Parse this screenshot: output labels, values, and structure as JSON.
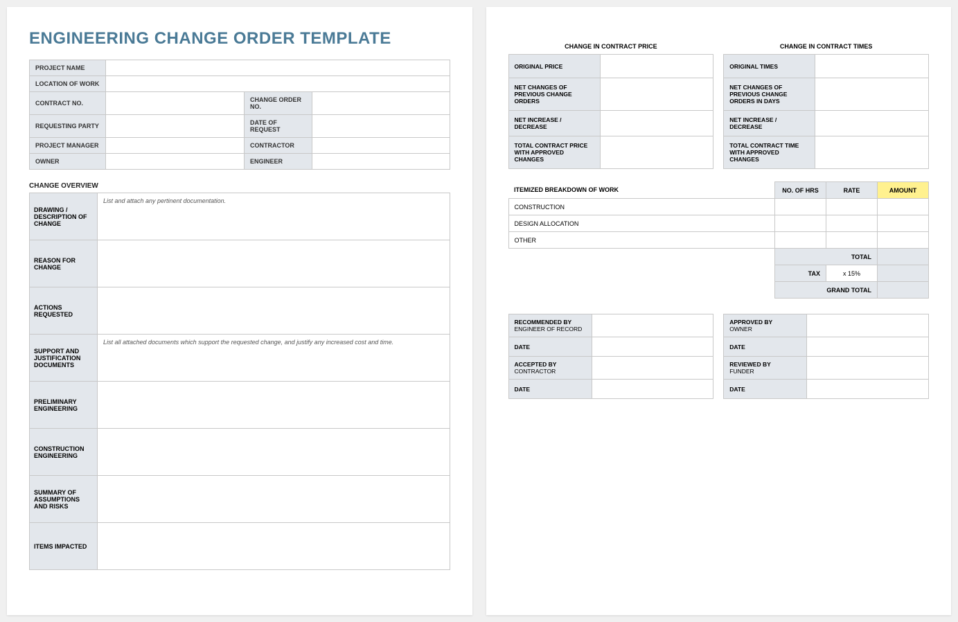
{
  "title": "ENGINEERING CHANGE ORDER TEMPLATE",
  "info": {
    "projectName": {
      "label": "PROJECT NAME",
      "value": ""
    },
    "locationOfWork": {
      "label": "LOCATION OF WORK",
      "value": ""
    },
    "contractNo": {
      "label": "CONTRACT NO.",
      "value": ""
    },
    "changeOrderNo": {
      "label": "CHANGE ORDER NO.",
      "value": ""
    },
    "requestingParty": {
      "label": "REQUESTING PARTY",
      "value": ""
    },
    "dateOfRequest": {
      "label": "DATE OF REQUEST",
      "value": ""
    },
    "projectManager": {
      "label": "PROJECT MANAGER",
      "value": ""
    },
    "contractor": {
      "label": "CONTRACTOR",
      "value": ""
    },
    "owner": {
      "label": "OWNER",
      "value": ""
    },
    "engineer": {
      "label": "ENGINEER",
      "value": ""
    }
  },
  "overview": {
    "heading": "CHANGE OVERVIEW",
    "rows": [
      {
        "label": "DRAWING / DESCRIPTION OF CHANGE",
        "value": "List and attach any pertinent documentation."
      },
      {
        "label": "REASON FOR CHANGE",
        "value": ""
      },
      {
        "label": "ACTIONS REQUESTED",
        "value": ""
      },
      {
        "label": "SUPPORT AND JUSTIFICATION DOCUMENTS",
        "value": "List all attached documents which support the requested change, and justify any increased cost and time."
      },
      {
        "label": "PRELIMINARY ENGINEERING",
        "value": ""
      },
      {
        "label": "CONSTRUCTION ENGINEERING",
        "value": ""
      },
      {
        "label": "SUMMARY OF ASSUMPTIONS AND RISKS",
        "value": ""
      },
      {
        "label": "ITEMS IMPACTED",
        "value": ""
      }
    ]
  },
  "changePrice": {
    "heading": "CHANGE IN CONTRACT PRICE",
    "rows": [
      {
        "label": "ORIGINAL PRICE",
        "value": ""
      },
      {
        "label": "NET CHANGES OF PREVIOUS CHANGE ORDERS",
        "value": ""
      },
      {
        "label": "NET INCREASE / DECREASE",
        "value": ""
      },
      {
        "label": "TOTAL CONTRACT PRICE WITH APPROVED CHANGES",
        "value": ""
      }
    ]
  },
  "changeTimes": {
    "heading": "CHANGE IN CONTRACT TIMES",
    "rows": [
      {
        "label": "ORIGINAL TIMES",
        "value": ""
      },
      {
        "label": "NET CHANGES OF PREVIOUS CHANGE ORDERS IN DAYS",
        "value": ""
      },
      {
        "label": "NET INCREASE / DECREASE",
        "value": ""
      },
      {
        "label": "TOTAL CONTRACT TIME WITH APPROVED CHANGES",
        "value": ""
      }
    ]
  },
  "itemized": {
    "heading": "ITEMIZED BREAKDOWN OF WORK",
    "columns": {
      "hrs": "NO. OF HRS",
      "rate": "RATE",
      "amount": "AMOUNT"
    },
    "rows": [
      {
        "desc": "CONSTRUCTION",
        "hrs": "",
        "rate": "",
        "amount": ""
      },
      {
        "desc": "DESIGN ALLOCATION",
        "hrs": "",
        "rate": "",
        "amount": ""
      },
      {
        "desc": "OTHER",
        "hrs": "",
        "rate": "",
        "amount": ""
      }
    ],
    "totalLabel": "TOTAL",
    "totalValue": "",
    "taxLabel": "TAX",
    "taxRate": "x 15%",
    "taxValue": "",
    "grandTotalLabel": "GRAND TOTAL",
    "grandTotalValue": ""
  },
  "signoff": {
    "left": [
      {
        "label": "RECOMMENDED BY",
        "sub": "ENGINEER OF RECORD",
        "value": ""
      },
      {
        "label": "DATE",
        "sub": "",
        "value": ""
      },
      {
        "label": "ACCEPTED BY",
        "sub": "CONTRACTOR",
        "value": ""
      },
      {
        "label": "DATE",
        "sub": "",
        "value": ""
      }
    ],
    "right": [
      {
        "label": "APPROVED BY",
        "sub": "OWNER",
        "value": ""
      },
      {
        "label": "DATE",
        "sub": "",
        "value": ""
      },
      {
        "label": "REVIEWED BY",
        "sub": "FUNDER",
        "value": ""
      },
      {
        "label": "DATE",
        "sub": "",
        "value": ""
      }
    ]
  }
}
